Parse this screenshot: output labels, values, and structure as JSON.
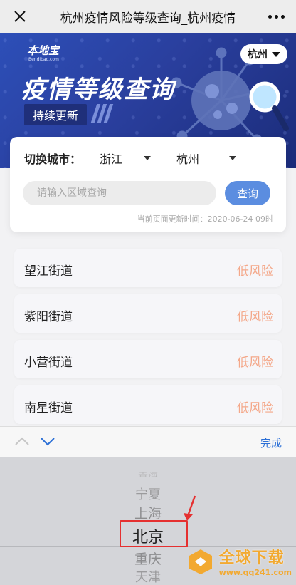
{
  "topbar": {
    "title": "杭州疫情风险等级查询_杭州疫情"
  },
  "banner": {
    "logo": "本地宝",
    "logo_sub": "Bendibao.com",
    "city": "杭州",
    "title": "疫情等级查询",
    "tag": "持续更新"
  },
  "filter": {
    "label": "切换城市：",
    "province": "浙江",
    "city": "杭州",
    "search_placeholder": "请输入区域查询",
    "query_button": "查询",
    "updated": "当前页面更新时间：2020-06-24 09时"
  },
  "streets": [
    {
      "name": "望江街道",
      "risk": "低风险"
    },
    {
      "name": "紫阳街道",
      "risk": "低风险"
    },
    {
      "name": "小营街道",
      "risk": "低风险"
    },
    {
      "name": "南星街道",
      "risk": "低风险"
    }
  ],
  "picker": {
    "done": "完成",
    "options": [
      "青海",
      "宁夏",
      "上海",
      "北京",
      "重庆",
      "天津"
    ],
    "selected": "北京"
  },
  "watermark": {
    "title": "全球下载",
    "url": "www.qq241.com"
  },
  "colors": {
    "banner": "#2a3f9e",
    "risk_low": "#f4a88a",
    "accent": "#5b8de0",
    "done": "#2b6fd6",
    "highlight": "#e53030"
  }
}
